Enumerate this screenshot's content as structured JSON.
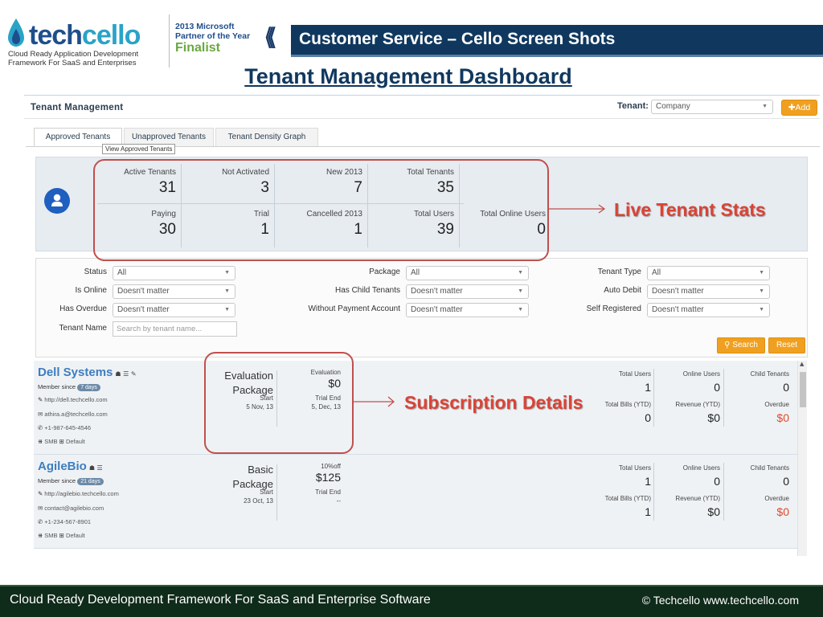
{
  "header": {
    "logo": {
      "wordmark_part1": "tech",
      "wordmark_part2": "cello",
      "tagline_line1": "Cloud Ready Application Development",
      "tagline_line2": "Framework For SaaS and Enterprises"
    },
    "award": {
      "line1": "2013 Microsoft",
      "line2": "Partner of the Year",
      "line3": "Finalist"
    },
    "title": "Customer Service – Cello Screen Shots",
    "subtitle": "Tenant Management Dashboard"
  },
  "app": {
    "title": "Tenant Management",
    "tenant_label": "Tenant:",
    "tenant_select": "Company",
    "add_button": "✚Add",
    "tabs": [
      {
        "label": "Approved Tenants",
        "active": true
      },
      {
        "label": "Unapproved Tenants",
        "active": false
      },
      {
        "label": "Tenant Density Graph",
        "active": false
      }
    ],
    "tooltip": "View Approved Tenants",
    "stats": [
      {
        "label": "Active Tenants",
        "value": "31"
      },
      {
        "label": "Not Activated",
        "value": "3"
      },
      {
        "label": "New 2013",
        "value": "7"
      },
      {
        "label": "Total Tenants",
        "value": "35"
      },
      {
        "label": "Paying",
        "value": "30"
      },
      {
        "label": "Trial",
        "value": "1"
      },
      {
        "label": "Cancelled 2013",
        "value": "1"
      },
      {
        "label": "Total Users",
        "value": "39"
      },
      {
        "label": "Total Online Users",
        "value": "0"
      }
    ],
    "filters": {
      "status": {
        "label": "Status",
        "value": "All"
      },
      "is_online": {
        "label": "Is Online",
        "value": "Doesn't matter"
      },
      "has_overdue": {
        "label": "Has Overdue",
        "value": "Doesn't matter"
      },
      "tenant_name": {
        "label": "Tenant Name",
        "placeholder": "Search by tenant name..."
      },
      "package": {
        "label": "Package",
        "value": "All"
      },
      "has_child_tenants": {
        "label": "Has Child Tenants",
        "value": "Doesn't matter"
      },
      "without_payment_account": {
        "label": "Without Payment Account",
        "value": "Doesn't matter"
      },
      "tenant_type": {
        "label": "Tenant Type",
        "value": "All"
      },
      "auto_debit": {
        "label": "Auto Debit",
        "value": "Doesn't matter"
      },
      "self_registered": {
        "label": "Self Registered",
        "value": "Doesn't matter"
      },
      "search_button": "Search",
      "reset_button": "Reset"
    },
    "tenants": [
      {
        "name": "Dell Systems",
        "member_since_label": "Member since",
        "member_since": "7 days",
        "website": "http://dell.techcello.com",
        "email": "athira.a@techcello.com",
        "phone": "+1-987-645-4546",
        "type": "SMB",
        "plan": "Default",
        "package": "Evaluation Package",
        "price_label": "Evaluation",
        "price": "$0",
        "start_label": "Start",
        "start": "5 Nov, 13",
        "trial_end_label": "Trial End",
        "trial_end": "5, Dec, 13",
        "total_users_label": "Total Users",
        "total_users": "1",
        "online_users_label": "Online Users",
        "online_users": "0",
        "child_tenants_label": "Child Tenants",
        "child_tenants": "0",
        "total_bills_label": "Total Bills (YTD)",
        "total_bills": "0",
        "revenue_label": "Revenue (YTD)",
        "revenue": "$0",
        "overdue_label": "Overdue",
        "overdue": "$0"
      },
      {
        "name": "AgileBio",
        "member_since_label": "Member since",
        "member_since": "21 days",
        "website": "http://agilebio.techcello.com",
        "email": "contact@agilebio.com",
        "phone": "+1-234-567-8901",
        "type": "SMB",
        "plan": "Default",
        "package": "Basic Package",
        "price_label": "10%off",
        "price": "$125",
        "start_label": "Start",
        "start": "23 Oct, 13",
        "trial_end_label": "Trial End",
        "trial_end": "--",
        "total_users_label": "Total Users",
        "total_users": "1",
        "online_users_label": "Online Users",
        "online_users": "0",
        "child_tenants_label": "Child Tenants",
        "child_tenants": "0",
        "total_bills_label": "Total Bills (YTD)",
        "total_bills": "1",
        "revenue_label": "Revenue (YTD)",
        "revenue": "$0",
        "overdue_label": "Overdue",
        "overdue": "$0"
      }
    ]
  },
  "callouts": {
    "stats": "Live Tenant Stats",
    "subscription": "Subscription Details"
  },
  "footer": {
    "text": "Cloud Ready Development Framework For SaaS and Enterprise Software",
    "copyright": "© Techcello www.techcello.com"
  },
  "colors": {
    "accent": "#f0a020",
    "header_band": "#10385f",
    "callout": "#d94436",
    "footer": "#0f2b1a",
    "link": "#3e7dbf"
  }
}
